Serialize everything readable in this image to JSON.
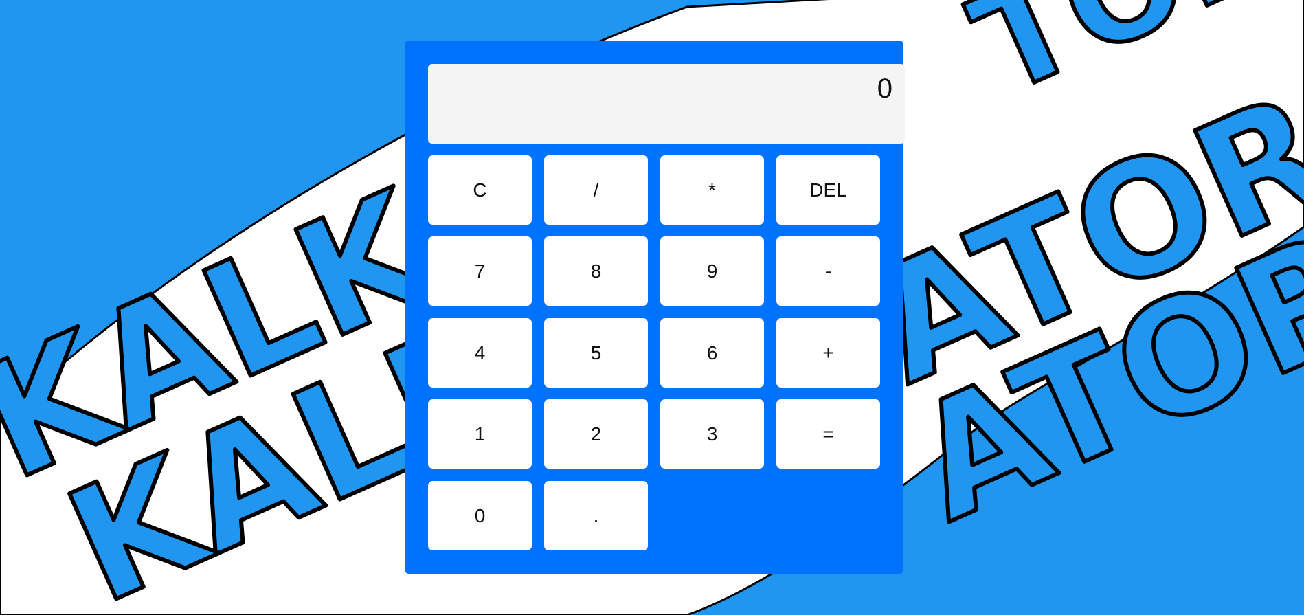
{
  "background": {
    "colors": {
      "sky": "#2196f0",
      "band": "#ffffff",
      "letter_fill": "#2196f0",
      "letter_outline": "#000000"
    },
    "watermark_text": "KALKULATOR"
  },
  "calculator": {
    "panel_color": "#0073fe",
    "display": {
      "value": "0",
      "background": "#f4f4f4"
    },
    "keys": [
      {
        "id": "clear",
        "label": "C"
      },
      {
        "id": "divide",
        "label": "/"
      },
      {
        "id": "multiply",
        "label": "*"
      },
      {
        "id": "delete",
        "label": "DEL"
      },
      {
        "id": "seven",
        "label": "7"
      },
      {
        "id": "eight",
        "label": "8"
      },
      {
        "id": "nine",
        "label": "9"
      },
      {
        "id": "subtract",
        "label": "-"
      },
      {
        "id": "four",
        "label": "4"
      },
      {
        "id": "five",
        "label": "5"
      },
      {
        "id": "six",
        "label": "6"
      },
      {
        "id": "add",
        "label": "+"
      },
      {
        "id": "one",
        "label": "1"
      },
      {
        "id": "two",
        "label": "2"
      },
      {
        "id": "three",
        "label": "3"
      },
      {
        "id": "equals",
        "label": "="
      },
      {
        "id": "zero",
        "label": "0"
      },
      {
        "id": "decimal",
        "label": "."
      }
    ]
  }
}
